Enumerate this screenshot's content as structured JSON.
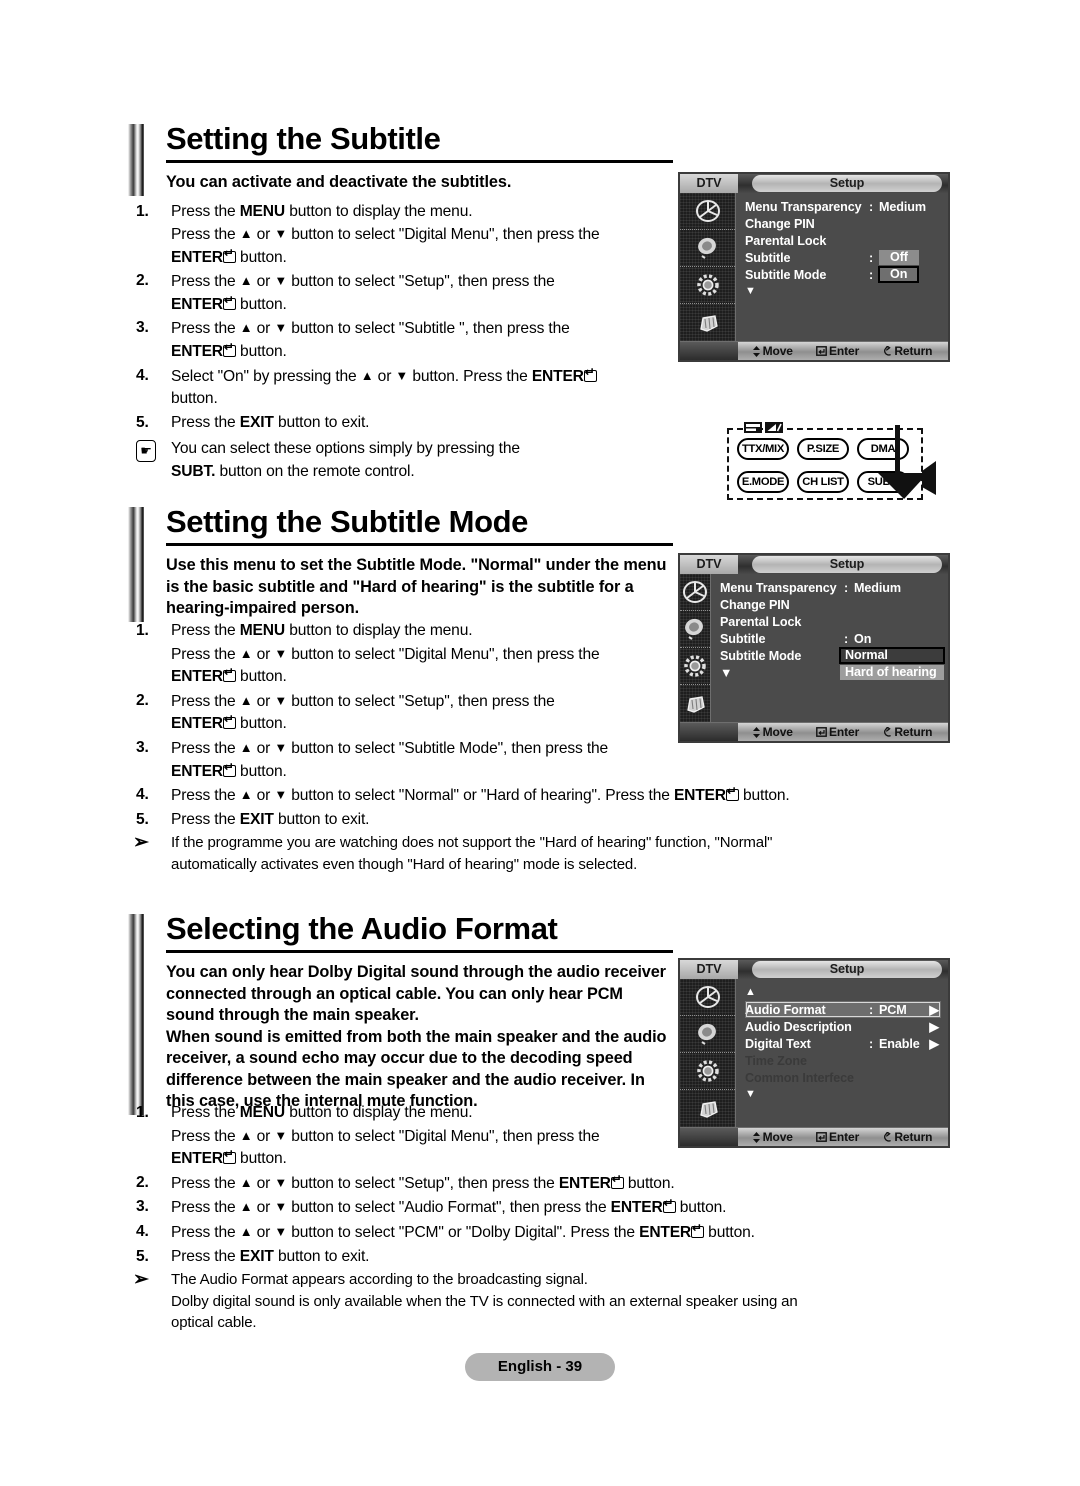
{
  "sections": [
    {
      "id": "subtitle",
      "heading": "Setting the Subtitle",
      "lead": "You can activate and deactivate the subtitles.",
      "steps": [
        {
          "num": "1.",
          "lines": [
            "Press the <b>MENU</b> button to display the menu.",
            "Press the <span class=\"tri\">▲</span> or <span class=\"tri\">▼</span> button to select \"Digital Menu\", then press the",
            "<span class=\"ent\">ENTER</span><span class=\"entglyph\"></span> button."
          ]
        },
        {
          "num": "2.",
          "lines": [
            "Press the <span class=\"tri\">▲</span> or <span class=\"tri\">▼</span> button to select \"Setup\", then press the",
            "<span class=\"ent\">ENTER</span><span class=\"entglyph\"></span> button."
          ]
        },
        {
          "num": "3.",
          "lines": [
            "Press the <span class=\"tri\">▲</span> or <span class=\"tri\">▼</span> button to select \"Subtitle \", then press the",
            "<span class=\"ent\">ENTER</span><span class=\"entglyph\"></span> button."
          ]
        },
        {
          "num": "4.",
          "lines": [
            "Select \"On\" by pressing the <span class=\"tri\">▲</span> or <span class=\"tri\">▼</span> button. Press the <span class=\"ent\">ENTER</span><span class=\"entglyph\"></span>",
            "button."
          ]
        },
        {
          "num": "5.",
          "lines": [
            "Press the <b>EXIT</b> button to exit."
          ]
        }
      ],
      "notes": [
        {
          "icon": "hand-press-icon",
          "lines": [
            "You can select these options simply by pressing the",
            "<b>SUBT.</b> button on the remote control."
          ]
        }
      ]
    },
    {
      "id": "subtitle-mode",
      "heading": "Setting the Subtitle Mode",
      "lead": "Use this menu to set the Subtitle Mode. \"Normal\" under the menu is the basic subtitle and \"Hard of hearing\" is the subtitle for a hearing-impaired person.",
      "steps": [
        {
          "num": "1.",
          "lines": [
            "Press the <b>MENU</b> button to display the menu.",
            "Press the <span class=\"tri\">▲</span> or <span class=\"tri\">▼</span> button to select \"Digital Menu\", then press the",
            "<span class=\"ent\">ENTER</span><span class=\"entglyph\"></span> button."
          ]
        },
        {
          "num": "2.",
          "lines": [
            "Press the <span class=\"tri\">▲</span> or <span class=\"tri\">▼</span> button to select \"Setup\", then press the",
            "<span class=\"ent\">ENTER</span><span class=\"entglyph\"></span> button."
          ]
        },
        {
          "num": "3.",
          "lines": [
            "Press the <span class=\"tri\">▲</span> or <span class=\"tri\">▼</span> button to select \"Subtitle Mode\", then press the",
            "<span class=\"ent\">ENTER</span><span class=\"entglyph\"></span> button."
          ]
        },
        {
          "num": "4.",
          "lines": [
            "Press the <span class=\"tri\">▲</span> or <span class=\"tri\">▼</span> button to select \"Normal\" or \"Hard of hearing\". Press the <span class=\"ent\">ENTER</span><span class=\"entglyph\"></span> button."
          ]
        },
        {
          "num": "5.",
          "lines": [
            "Press the <b>EXIT</b> button to exit."
          ]
        }
      ],
      "notes": [
        {
          "icon": "arrow-note-icon",
          "lines": [
            "If the programme you are watching does not support the \"Hard of hearing\" function, \"Normal\"",
            "automatically activates even though \"Hard of hearing\" mode is selected."
          ]
        }
      ]
    },
    {
      "id": "audio-format",
      "heading": "Selecting the Audio Format",
      "lead": "You can only hear Dolby Digital sound through the audio receiver connected through an optical cable. You can only hear PCM sound through the main speaker.\nWhen sound is emitted from both the main speaker and the audio receiver, a sound echo may occur due to the decoding speed difference between the main speaker and the audio receiver. In this case, use the internal mute function.",
      "steps": [
        {
          "num": "1.",
          "lines": [
            "Press the <b>MENU</b> button to display the menu.",
            "Press the <span class=\"tri\">▲</span> or <span class=\"tri\">▼</span> button to select \"Digital Menu\", then press the",
            "<span class=\"ent\">ENTER</span><span class=\"entglyph\"></span> button."
          ]
        },
        {
          "num": "2.",
          "lines": [
            "Press the <span class=\"tri\">▲</span> or <span class=\"tri\">▼</span> button to select \"Setup\", then press the <span class=\"ent\">ENTER</span><span class=\"entglyph\"></span> button."
          ]
        },
        {
          "num": "3.",
          "lines": [
            "Press the <span class=\"tri\">▲</span> or <span class=\"tri\">▼</span> button to select \"Audio Format\", then press the <span class=\"ent\">ENTER</span><span class=\"entglyph\"></span> button."
          ]
        },
        {
          "num": "4.",
          "lines": [
            "Press the <span class=\"tri\">▲</span> or <span class=\"tri\">▼</span> button to select \"PCM\" or \"Dolby Digital\". Press the <span class=\"ent\">ENTER</span><span class=\"entglyph\"></span> button."
          ]
        },
        {
          "num": "5.",
          "lines": [
            "Press the <b>EXIT</b> button to exit."
          ]
        }
      ],
      "notes": [
        {
          "icon": "arrow-note-icon",
          "lines": [
            "The Audio Format appears according to the broadcasting signal.",
            "Dolby digital sound is only available when the TV is connected with an external speaker using an",
            "optical cable."
          ]
        }
      ]
    }
  ],
  "osd_menus": [
    {
      "id": "osd-subtitle",
      "source_label": "DTV",
      "title": "Setup",
      "sidebar_icons": [
        "channel-icon",
        "picture-icon",
        "sound-icon",
        "setup-hand-icon"
      ],
      "rows": [
        {
          "label": "Menu Transparency",
          "colon": ":",
          "value": "Medium",
          "style": "plain"
        },
        {
          "label": "Change PIN",
          "colon": "",
          "value": "",
          "style": "plain"
        },
        {
          "label": "Parental Lock",
          "colon": "",
          "value": "",
          "style": "plain"
        },
        {
          "label": "Subtitle",
          "colon": ":",
          "value": "Off",
          "style": "box"
        },
        {
          "label": "Subtitle Mode",
          "colon": ":",
          "value": "On",
          "style": "box-selected"
        },
        {
          "label": "▼",
          "colon": "",
          "value": "",
          "style": "scroll"
        }
      ],
      "footer": [
        {
          "icon": "updown-icon",
          "glyph": "⬍",
          "label": "Move"
        },
        {
          "icon": "enter-icon",
          "glyph": "↵",
          "label": "Enter"
        },
        {
          "icon": "return-icon",
          "glyph": "↺",
          "label": "Return"
        }
      ]
    },
    {
      "id": "osd-subtitle-mode",
      "source_label": "DTV",
      "title": "Setup",
      "sidebar_icons": [
        "channel-icon",
        "picture-icon",
        "sound-icon",
        "setup-hand-icon"
      ],
      "rows": [
        {
          "label": "Menu Transparency",
          "colon": ":",
          "value": "Medium",
          "style": "plain"
        },
        {
          "label": "Change PIN",
          "colon": "",
          "value": "",
          "style": "plain"
        },
        {
          "label": "Parental Lock",
          "colon": "",
          "value": "",
          "style": "plain"
        },
        {
          "label": "Subtitle",
          "colon": ":",
          "value": "On",
          "style": "plain"
        },
        {
          "label": "Subtitle Mode",
          "colon": "",
          "value": "Normal",
          "style": "dropdown-selected"
        },
        {
          "label": "▼",
          "colon": "",
          "value": "Hard of hearing",
          "style": "dropdown-option"
        }
      ],
      "footer": [
        {
          "icon": "updown-icon",
          "glyph": "⬍",
          "label": "Move"
        },
        {
          "icon": "enter-icon",
          "glyph": "↵",
          "label": "Enter"
        },
        {
          "icon": "return-icon",
          "glyph": "↺",
          "label": "Return"
        }
      ]
    },
    {
      "id": "osd-audio-format",
      "source_label": "DTV",
      "title": "Setup",
      "sidebar_icons": [
        "channel-icon",
        "picture-icon",
        "sound-icon",
        "setup-hand-icon"
      ],
      "rows": [
        {
          "label": "▲",
          "colon": "",
          "value": "",
          "style": "scroll-up"
        },
        {
          "label": "Audio Format",
          "colon": ":",
          "value": "PCM",
          "style": "highlighted-arrow"
        },
        {
          "label": "Audio Description",
          "colon": "",
          "value": "",
          "style": "arrow"
        },
        {
          "label": "Digital Text",
          "colon": ":",
          "value": "Enable",
          "style": "arrow"
        },
        {
          "label": "Time Zone",
          "colon": "",
          "value": "",
          "style": "disabled"
        },
        {
          "label": "Common Interfece",
          "colon": "",
          "value": "",
          "style": "disabled"
        },
        {
          "label": "▼",
          "colon": "",
          "value": "",
          "style": "scroll"
        }
      ],
      "footer": [
        {
          "icon": "updown-icon",
          "glyph": "⬍",
          "label": "Move"
        },
        {
          "icon": "enter-icon",
          "glyph": "↵",
          "label": "Enter"
        },
        {
          "icon": "return-icon",
          "glyph": "↺",
          "label": "Return"
        }
      ]
    }
  ],
  "remote": {
    "buttons": [
      {
        "label": "TTX/MIX"
      },
      {
        "label": "P.SIZE"
      },
      {
        "label": "DMA"
      },
      {
        "label": "E.MODE"
      },
      {
        "label": "CH LIST"
      },
      {
        "label": "SUBT."
      }
    ]
  },
  "footer": {
    "page_label": "English - 39"
  }
}
